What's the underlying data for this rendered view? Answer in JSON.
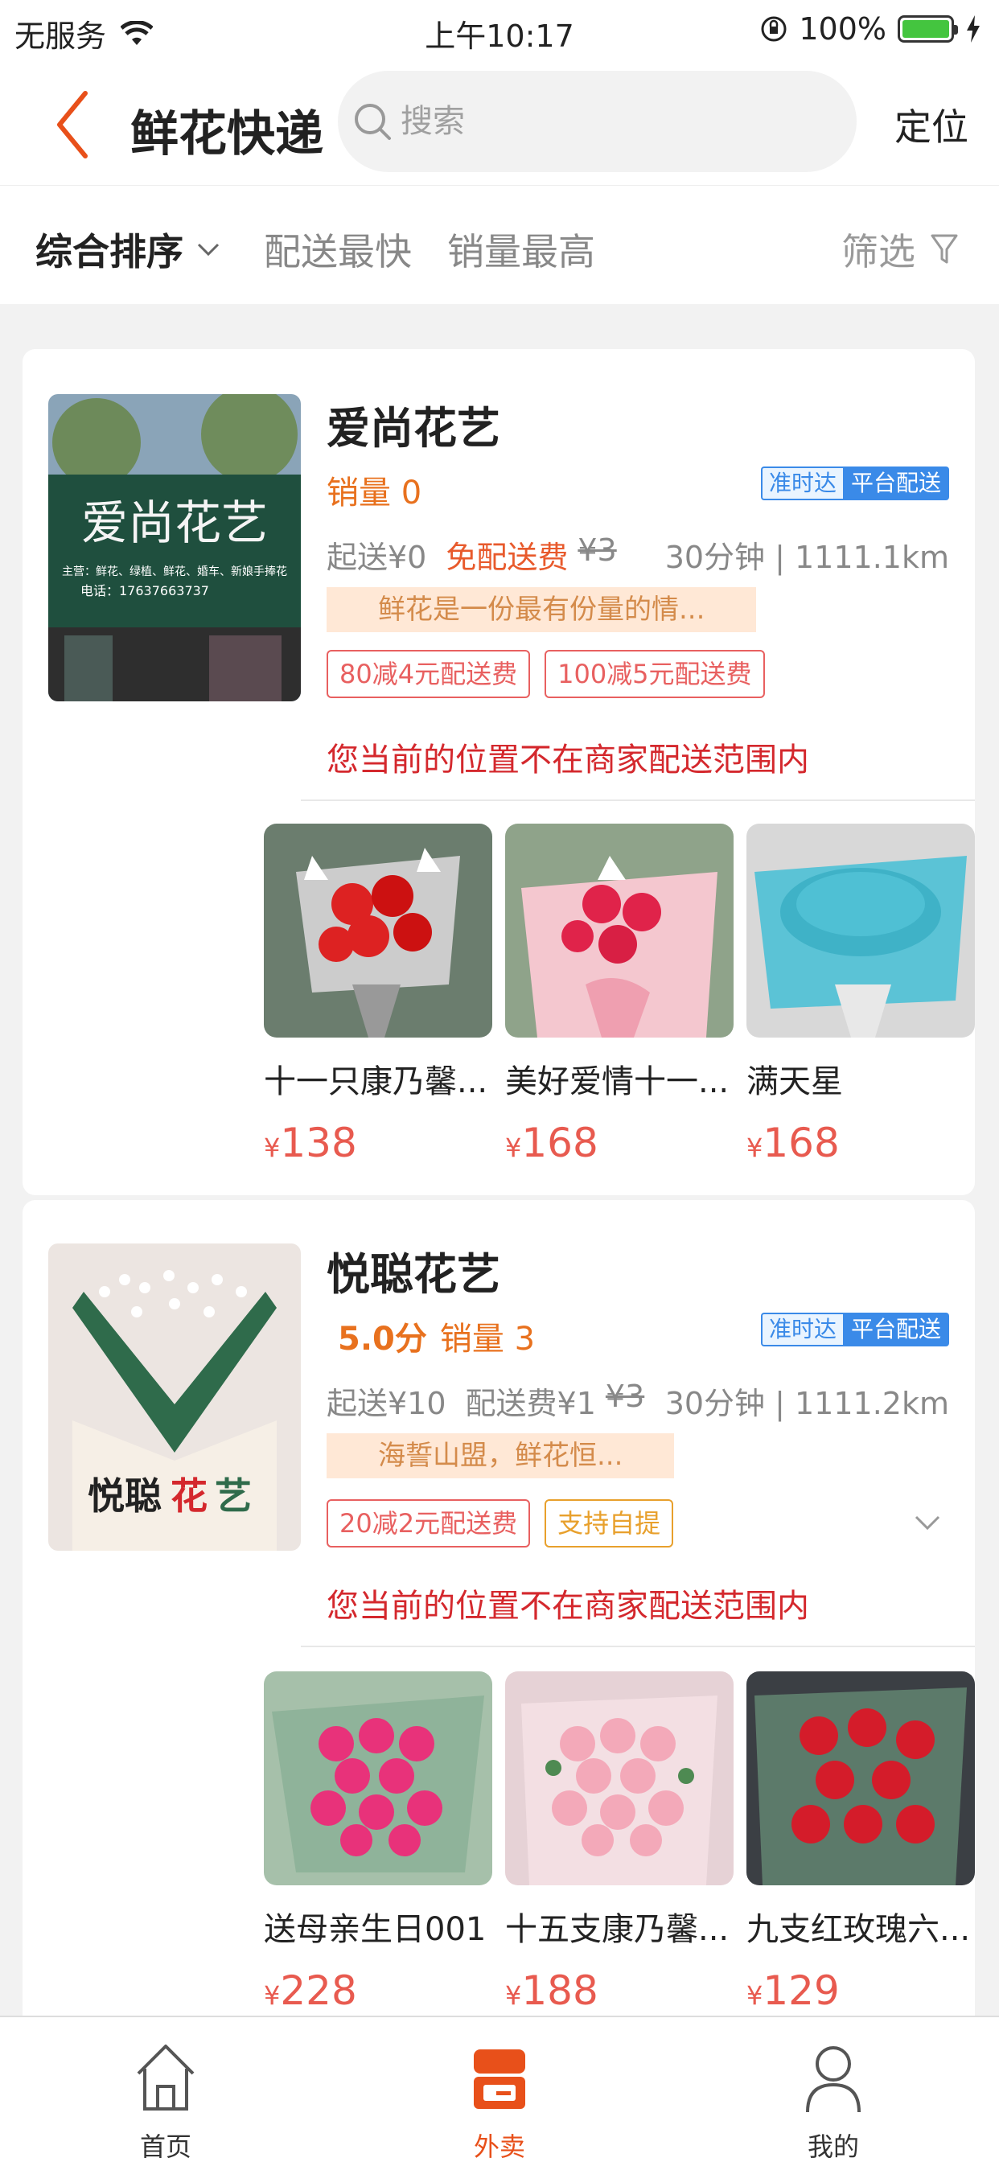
{
  "status_bar": {
    "carrier": "无服务",
    "time": "上午10:17",
    "battery": "100%"
  },
  "header": {
    "title": "鲜花快递",
    "search_placeholder": "搜索",
    "locate_label": "定位"
  },
  "sort_bar": {
    "items": [
      "综合排序",
      "配送最快",
      "销量最高"
    ],
    "filter_label": "筛选"
  },
  "shops": [
    {
      "name": "爱尚花艺",
      "sign_text": "爱尚花艺",
      "sign_sub": "主营：鲜花、绿植、鲜花、婚车、新娘手捧花",
      "sign_phone": "电话：17637663737",
      "rating": "",
      "sales": "销量 0",
      "tag_ontime": "准时达",
      "tag_platform": "平台配送",
      "min_order": "起送¥0",
      "delivery_fee": "免配送费",
      "original_fee": "¥3",
      "eta_distance": "30分钟 | 1111.1km",
      "slogan": "鲜花是一份最有份量的情...",
      "coupons": [
        "80减4元配送费",
        "100减5元配送费"
      ],
      "out_of_range": "您当前的位置不在商家配送范围内",
      "products": [
        {
          "name": "十一只康乃馨...",
          "currency": "¥",
          "price": "138"
        },
        {
          "name": "美好爱情十一...",
          "currency": "¥",
          "price": "168"
        },
        {
          "name": "满天星",
          "currency": "¥",
          "price": "168"
        }
      ]
    },
    {
      "name": "悦聪花艺",
      "logo_text_a": "悦聪",
      "logo_text_b": "花",
      "logo_text_c": "艺",
      "rating": "5.0分",
      "sales": "销量 3",
      "tag_ontime": "准时达",
      "tag_platform": "平台配送",
      "min_order": "起送¥10",
      "delivery_fee": "配送费¥1",
      "original_fee": "¥3",
      "eta_distance": "30分钟 | 1111.2km",
      "slogan": "海誓山盟，鲜花恒...",
      "coupons": [
        "20减2元配送费",
        "支持自提"
      ],
      "out_of_range": "您当前的位置不在商家配送范围内",
      "products": [
        {
          "name": "送母亲生日001",
          "currency": "¥",
          "price": "228"
        },
        {
          "name": "十五支康乃馨...",
          "currency": "¥",
          "price": "188"
        },
        {
          "name": "九支红玫瑰六...",
          "currency": "¥",
          "price": "129"
        }
      ]
    }
  ],
  "tabbar": {
    "items": [
      "首页",
      "外卖",
      "我的"
    ],
    "active": "外卖"
  },
  "colors": {
    "accent": "#e8501a",
    "price": "#e85a4f",
    "warning": "#d4282d",
    "tag_blue": "#3a8ae8"
  }
}
